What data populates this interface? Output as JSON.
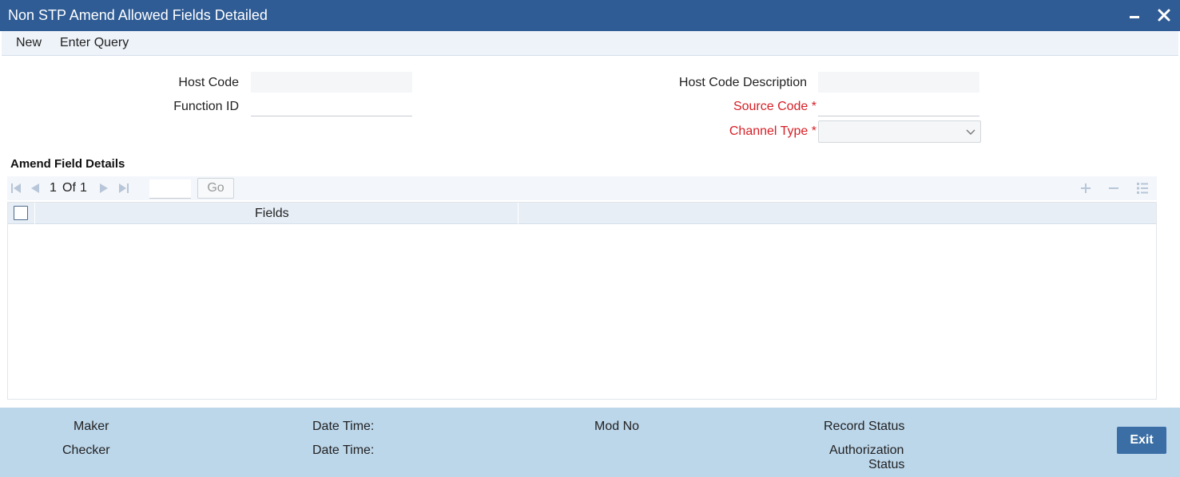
{
  "window": {
    "title": "Non STP Amend Allowed Fields Detailed",
    "icons": [
      "minimize-icon",
      "close-icon"
    ]
  },
  "toolbar": {
    "new_label": "New",
    "enter_query_label": "Enter Query"
  },
  "form": {
    "host_code": {
      "label": "Host Code",
      "value": ""
    },
    "host_code_description": {
      "label": "Host Code Description",
      "value": ""
    },
    "function_id": {
      "label": "Function ID",
      "value": ""
    },
    "source_code": {
      "label": "Source Code *",
      "value": ""
    },
    "channel_type": {
      "label": "Channel Type *",
      "selected": ""
    }
  },
  "amend_section": {
    "title": "Amend Field Details",
    "pager": {
      "current": "1",
      "of_label": "Of",
      "total": "1",
      "go_label": "Go"
    },
    "columns": [
      "Fields"
    ],
    "rows": []
  },
  "footer": {
    "maker_label": "Maker",
    "checker_label": "Checker",
    "date_time_label_1": "Date Time:",
    "date_time_label_2": "Date Time:",
    "mod_no_label": "Mod No",
    "record_status_label": "Record Status",
    "authorization_status_label_1": "Authorization",
    "authorization_status_label_2": "Status",
    "exit_label": "Exit"
  },
  "colors": {
    "titlebar": "#2f5c94",
    "required": "#d61f26",
    "footer": "#bcd6ea",
    "exit_button": "#3a6ea5"
  }
}
